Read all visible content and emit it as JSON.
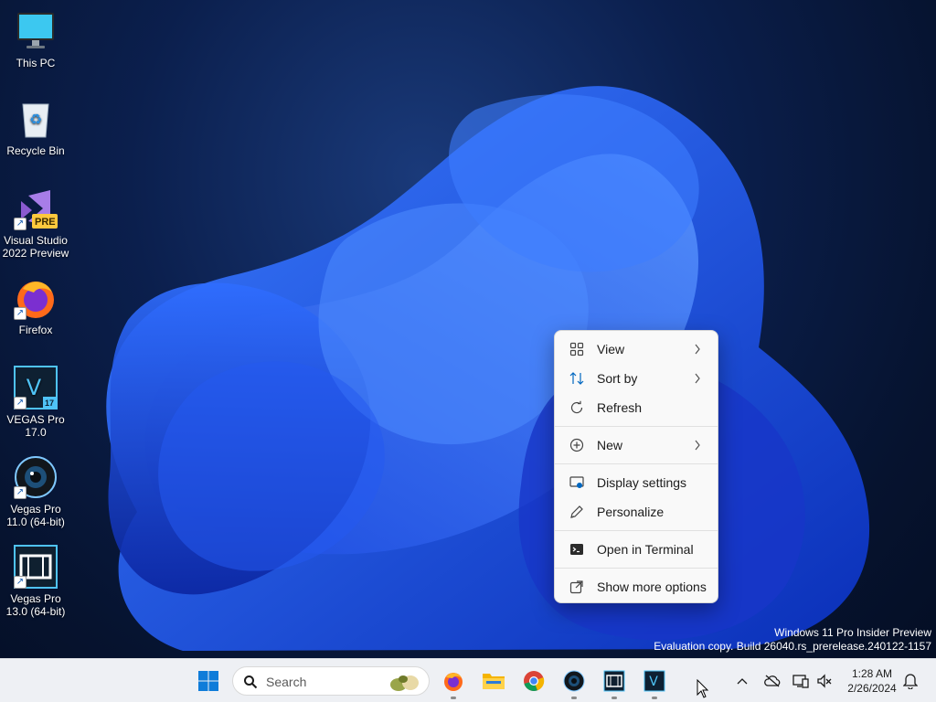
{
  "desktop": {
    "icons": [
      {
        "label": "This PC",
        "icon": "monitor-icon"
      },
      {
        "label": "Recycle Bin",
        "icon": "recycle-bin-icon"
      },
      {
        "label": "Visual Studio 2022 Preview",
        "icon": "visual-studio-icon",
        "badge": "PRE"
      },
      {
        "label": "Firefox",
        "icon": "firefox-icon"
      },
      {
        "label": "VEGAS Pro 17.0",
        "icon": "vegas-pro-17-icon",
        "badge": "17"
      },
      {
        "label": "Vegas Pro 11.0 (64-bit)",
        "icon": "vegas-pro-11-icon"
      },
      {
        "label": "Vegas Pro 13.0 (64-bit)",
        "icon": "vegas-pro-13-icon"
      }
    ]
  },
  "context_menu": {
    "items": [
      {
        "label": "View",
        "icon": "grid-view-icon",
        "submenu": true
      },
      {
        "label": "Sort by",
        "icon": "sort-icon",
        "submenu": true
      },
      {
        "label": "Refresh",
        "icon": "refresh-icon",
        "submenu": false
      },
      {
        "label": "New",
        "icon": "plus-circle-icon",
        "submenu": true
      },
      {
        "label": "Display settings",
        "icon": "display-settings-icon",
        "submenu": false
      },
      {
        "label": "Personalize",
        "icon": "pen-icon",
        "submenu": false
      },
      {
        "label": "Open in Terminal",
        "icon": "terminal-icon",
        "submenu": false
      },
      {
        "label": "Show more options",
        "icon": "external-icon",
        "submenu": false
      }
    ]
  },
  "watermark": {
    "line1": "Windows 11 Pro Insider Preview",
    "line2": "Evaluation copy. Build 26040.rs_prerelease.240122-1157"
  },
  "taskbar": {
    "search_placeholder": "Search",
    "apps": [
      "start-icon",
      "firefox-icon",
      "file-explorer-icon",
      "chrome-icon",
      "vegas-pro-11-icon",
      "vegas-pro-13-icon",
      "vegas-pro-17-icon"
    ],
    "clock": {
      "time": "1:28 AM",
      "date": "2/26/2024"
    }
  },
  "colors": {
    "accent": "#0067c0",
    "taskbar_bg": "#eef0f4",
    "menu_bg": "#f9f9f9"
  }
}
